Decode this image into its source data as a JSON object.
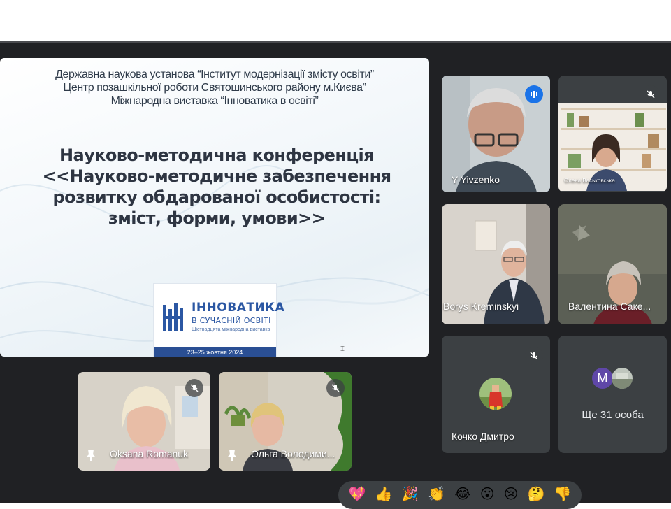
{
  "slide": {
    "org_line1": "Державна наукова установа “Інститут модернізації змісту освіти”",
    "org_line2": "Центр позашкільної роботи Святошинського району м.Києва”",
    "org_line3": "Міжнародна виставка “Інноватика в освіті”",
    "title_line1": "Науково-методична конференція",
    "title_line2": "<<Науково-методичне забезпечення",
    "title_line3": "розвитку обдарованої особистості:",
    "title_line4": "зміст, форми, умови>>",
    "logo_title": "ІННОВАТИКА",
    "logo_subtitle": "В СУЧАСНІЙ ОСВІТІ",
    "logo_tagline": "Шістнадцята міжнародна виставка",
    "logo_dates": "23–25 жовтня 2024"
  },
  "participants": [
    {
      "name": "Y Yivzenko",
      "state": "speaking"
    },
    {
      "name": "Олена Васьковська",
      "state": "muted"
    },
    {
      "name": "Borys Kreminskyi",
      "state": "unmuted"
    },
    {
      "name": "Валентина Саке...",
      "state": "unmuted"
    },
    {
      "name": "Кочко Дмитро",
      "state": "muted"
    },
    {
      "name": "Oksana Romanuk",
      "state": "muted",
      "pinned": true
    },
    {
      "name": "Ольга Володими...",
      "state": "muted",
      "pinned": true
    }
  ],
  "more": {
    "avatar_letter": "M",
    "label": "Ще 31 особа",
    "avatar_color": "#5f47a8"
  },
  "reactions": [
    "💖",
    "👍",
    "🎉",
    "👏",
    "😂",
    "😮",
    "😢",
    "🤔",
    "👎"
  ],
  "colors": {
    "stage": "#202124",
    "tile": "#3c4043",
    "accent": "#1a73e8",
    "active_border": "#8ab4f8"
  }
}
